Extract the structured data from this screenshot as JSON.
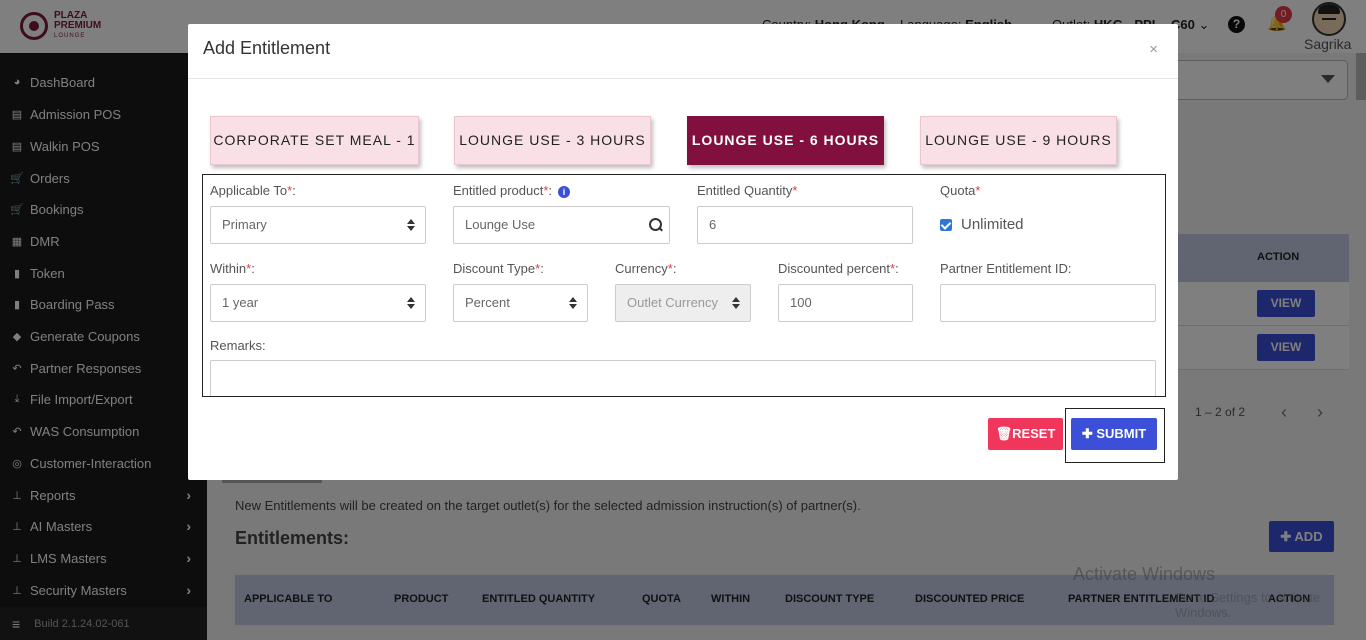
{
  "header": {
    "brand_line1": "PLAZA",
    "brand_line2": "PREMIUM",
    "brand_line3": "LOUNGE",
    "country_label": "Country:",
    "country_value": "Hong Kong",
    "language_label": "Language:",
    "language_value": "English",
    "outlet_label": "Outlet:",
    "outlet_value": "HKG - PPL - C60",
    "notification_count": "0",
    "username": "Sagrika"
  },
  "sidebar": {
    "items": [
      {
        "label": "DashBoard",
        "icon": "dashboard-icon"
      },
      {
        "label": "Admission POS",
        "icon": "card-icon"
      },
      {
        "label": "Walkin POS",
        "icon": "card-icon"
      },
      {
        "label": "Orders",
        "icon": "cart-icon"
      },
      {
        "label": "Bookings",
        "icon": "cart-icon"
      },
      {
        "label": "DMR",
        "icon": "calendar-icon"
      },
      {
        "label": "Token",
        "icon": "file-icon"
      },
      {
        "label": "Boarding Pass",
        "icon": "file-icon"
      },
      {
        "label": "Generate Coupons",
        "icon": "tag-icon"
      },
      {
        "label": "Partner Responses",
        "icon": "reply-icon"
      },
      {
        "label": "File Import/Export",
        "icon": "download-icon"
      },
      {
        "label": "WAS Consumption",
        "icon": "reply-icon"
      },
      {
        "label": "Customer-Interaction",
        "icon": "chat-icon"
      },
      {
        "label": "Reports",
        "icon": "sitemap-icon"
      },
      {
        "label": "AI Masters",
        "icon": "sitemap-icon"
      },
      {
        "label": "LMS Masters",
        "icon": "sitemap-icon"
      },
      {
        "label": "Security Masters",
        "icon": "sitemap-icon"
      }
    ],
    "build": "Build 2.1.24.02-061"
  },
  "background": {
    "action_header": "ACTION",
    "view_label": "VIEW",
    "pager_text": "1 – 2 of 2",
    "info_text": "New Entitlements will be created on the target outlet(s) for the selected admission instruction(s) of partner(s).",
    "entitlements_title": "Entitlements:",
    "add_label": "ADD",
    "columns": [
      "APPLICABLE TO",
      "PRODUCT",
      "ENTITLED QUANTITY",
      "QUOTA",
      "WITHIN",
      "DISCOUNT TYPE",
      "DISCOUNTED PRICE",
      "PARTNER ENTITLEMENT ID",
      "ACTION"
    ],
    "watermark_line1": "Activate Windows",
    "watermark_line2": "Go to Settings to activate Windows."
  },
  "modal": {
    "title": "Add Entitlement",
    "close": "×",
    "tabs": [
      {
        "label": "CORPORATE SET MEAL - 1",
        "active": false
      },
      {
        "label": "LOUNGE USE - 3 HOURS",
        "active": false
      },
      {
        "label": "LOUNGE USE - 6 HOURS",
        "active": true
      },
      {
        "label": "LOUNGE USE - 9 HOURS",
        "active": false
      }
    ],
    "form": {
      "applicable_to_label": "Applicable To",
      "applicable_to_value": "Primary",
      "entitled_product_label": "Entitled product",
      "entitled_product_placeholder": "Lounge Use",
      "entitled_quantity_label": "Entitled Quantity",
      "entitled_quantity_value": "6",
      "quota_label": "Quota",
      "unlimited_label": "Unlimited",
      "unlimited_checked": true,
      "within_label": "Within",
      "within_value": "1 year",
      "discount_type_label": "Discount Type",
      "discount_type_value": "Percent",
      "currency_label": "Currency",
      "currency_value": "Outlet Currency",
      "discounted_percent_label": "Discounted percent",
      "discounted_percent_value": "100",
      "partner_entitlement_id_label": "Partner Entitlement ID:",
      "partner_entitlement_id_value": "",
      "remarks_label": "Remarks:",
      "required_mark": "*",
      "colon": ":"
    },
    "reset_label": "RESET",
    "submit_label": "SUBMIT"
  },
  "colors": {
    "brand": "#82103f",
    "primary_button": "#3b4fd8",
    "reset_button": "#f0365a",
    "sidebar_bg": "#1a1a1a"
  }
}
